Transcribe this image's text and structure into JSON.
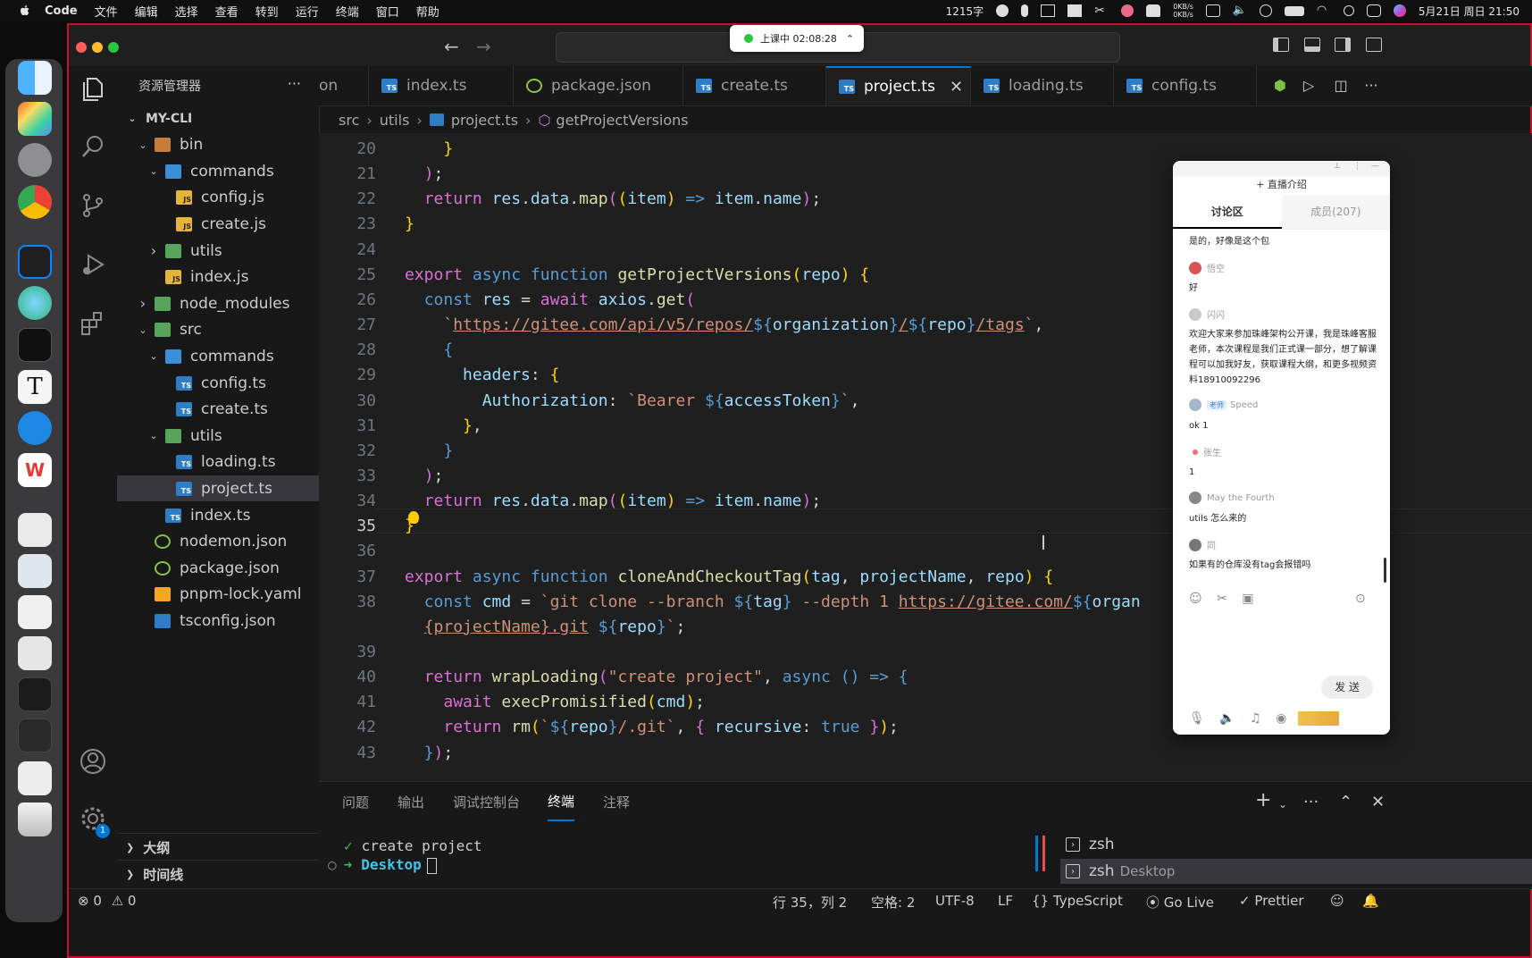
{
  "menubar": {
    "app_name": "Code",
    "items": [
      "文件",
      "编辑",
      "选择",
      "查看",
      "转到",
      "运行",
      "终端",
      "窗口",
      "帮助"
    ],
    "input_count": "1215字",
    "net_up": "0KB/s",
    "net_down": "0KB/s",
    "datetime": "5月21日 周日 21:50"
  },
  "titlebar": {
    "class_status": "上课中 02:08:28"
  },
  "sidebar": {
    "title": "资源管理器",
    "more": "···",
    "tree": [
      {
        "label": "MY-CLI",
        "depth": 0,
        "chev": "down",
        "icon": "none"
      },
      {
        "label": "bin",
        "depth": 1,
        "chev": "down",
        "icon": "folder"
      },
      {
        "label": "commands",
        "depth": 2,
        "chev": "down",
        "icon": "folder-blue"
      },
      {
        "label": "config.js",
        "depth": 3,
        "chev": "",
        "icon": "js"
      },
      {
        "label": "create.js",
        "depth": 3,
        "chev": "",
        "icon": "js"
      },
      {
        "label": "utils",
        "depth": 2,
        "chev": "right",
        "icon": "folder-green"
      },
      {
        "label": "index.js",
        "depth": 2,
        "chev": "",
        "icon": "js"
      },
      {
        "label": "node_modules",
        "depth": 1,
        "chev": "right",
        "icon": "folder-green"
      },
      {
        "label": "src",
        "depth": 1,
        "chev": "down",
        "icon": "folder-green"
      },
      {
        "label": "commands",
        "depth": 2,
        "chev": "down",
        "icon": "folder-blue"
      },
      {
        "label": "config.ts",
        "depth": 3,
        "chev": "",
        "icon": "ts"
      },
      {
        "label": "create.ts",
        "depth": 3,
        "chev": "",
        "icon": "ts"
      },
      {
        "label": "utils",
        "depth": 2,
        "chev": "down",
        "icon": "folder-green"
      },
      {
        "label": "loading.ts",
        "depth": 3,
        "chev": "",
        "icon": "ts"
      },
      {
        "label": "project.ts",
        "depth": 3,
        "chev": "",
        "icon": "ts",
        "selected": true
      },
      {
        "label": "index.ts",
        "depth": 2,
        "chev": "",
        "icon": "ts"
      },
      {
        "label": "nodemon.json",
        "depth": 1,
        "chev": "",
        "icon": "node"
      },
      {
        "label": "package.json",
        "depth": 1,
        "chev": "",
        "icon": "json"
      },
      {
        "label": "pnpm-lock.yaml",
        "depth": 1,
        "chev": "",
        "icon": "yaml"
      },
      {
        "label": "tsconfig.json",
        "depth": 1,
        "chev": "",
        "icon": "tsconfig"
      }
    ],
    "outline": "大纲",
    "timeline": "时间线"
  },
  "tabs": [
    {
      "label": "on",
      "icon": "none"
    },
    {
      "label": "index.ts",
      "icon": "ts"
    },
    {
      "label": "package.json",
      "icon": "json"
    },
    {
      "label": "create.ts",
      "icon": "ts"
    },
    {
      "label": "project.ts",
      "icon": "ts",
      "active": true
    },
    {
      "label": "loading.ts",
      "icon": "ts"
    },
    {
      "label": "config.ts",
      "icon": "ts"
    }
  ],
  "breadcrumb": [
    "src",
    "utils",
    "project.ts",
    "getProjectVersions"
  ],
  "editor": {
    "current_line": "35",
    "lines": [
      {
        "n": "20",
        "html": "    <span class='b'>}</span>"
      },
      {
        "n": "21",
        "html": "  <span class='pl'>)</span>;"
      },
      {
        "n": "22",
        "html": "  <span class='pl'>return</span> <span class='v'>res</span>.<span class='v'>data</span>.<span class='f'>map</span><span class='pl'>(</span><span class='b'>(</span><span class='v'>item</span><span class='b'>)</span> <span class='k'>=&gt;</span> <span class='v'>item</span>.<span class='v'>name</span><span class='pl'>)</span>;"
      },
      {
        "n": "23",
        "html": "<span class='b'>}</span>"
      },
      {
        "n": "24",
        "html": ""
      },
      {
        "n": "25",
        "html": "<span class='pl'>export</span> <span class='k'>async</span> <span class='k'>function</span> <span class='f'>getProjectVersions</span><span class='b'>(</span><span class='v'>repo</span><span class='b'>)</span> <span class='b'>{</span>"
      },
      {
        "n": "26",
        "html": "  <span class='k'>const</span> <span class='v'>res</span> = <span class='pl'>await</span> <span class='v'>axios</span>.<span class='f'>get</span><span class='pl'>(</span>"
      },
      {
        "n": "27",
        "html": "    <span class='s'>`</span><span class='u'>https://gitee.com/api/v5/repos/</span><span class='k'>${</span><span class='v'>organization</span><span class='k'>}</span><span class='u'>/</span><span class='k'>${</span><span class='v'>repo</span><span class='k'>}</span><span class='u'>/tags</span><span class='s'>`</span>,"
      },
      {
        "n": "28",
        "html": "    <span class='k'>{</span>"
      },
      {
        "n": "29",
        "html": "      <span class='v'>headers</span>: <span class='b'>{</span>"
      },
      {
        "n": "30",
        "html": "        <span class='v'>Authorization</span>: <span class='s'>`Bearer </span><span class='k'>${</span><span class='v'>accessToken</span><span class='k'>}</span><span class='s'>`</span>,"
      },
      {
        "n": "31",
        "html": "      <span class='b'>}</span>,"
      },
      {
        "n": "32",
        "html": "    <span class='k'>}</span>"
      },
      {
        "n": "33",
        "html": "  <span class='pl'>)</span>;"
      },
      {
        "n": "34",
        "html": "  <span class='pl'>return</span> <span class='v'>res</span>.<span class='v'>data</span>.<span class='f'>map</span><span class='pl'>(</span><span class='b'>(</span><span class='v'>item</span><span class='b'>)</span> <span class='k'>=&gt;</span> <span class='v'>item</span>.<span class='v'>name</span><span class='pl'>)</span>;"
      },
      {
        "n": "35",
        "html": "<span class='b'>}</span>"
      },
      {
        "n": "36",
        "html": ""
      },
      {
        "n": "37",
        "html": "<span class='pl'>export</span> <span class='k'>async</span> <span class='k'>function</span> <span class='f'>cloneAndCheckoutTag</span><span class='b'>(</span><span class='v'>tag</span>, <span class='v'>projectName</span>, <span class='v'>repo</span><span class='b'>)</span> <span class='b'>{</span>"
      },
      {
        "n": "38",
        "html": "  <span class='k'>const</span> <span class='v'>cmd</span> = <span class='s'>`git clone --branch </span><span class='k'>${</span><span class='v'>tag</span><span class='k'>}</span><span class='s'> --depth 1 </span><span class='u'>https://gitee.com/</span><span class='k'>${</span><span class='v'>organ</span>"
      },
      {
        "n": "",
        "html": "  <span class='u'>{projectName}.git</span><span class='s'> </span><span class='k'>${</span><span class='v'>repo</span><span class='k'>}</span><span class='s'>`</span>;"
      },
      {
        "n": "39",
        "html": ""
      },
      {
        "n": "40",
        "html": "  <span class='pl'>return</span> <span class='f'>wrapLoading</span><span class='pl'>(</span><span class='s'>\"create project\"</span>, <span class='k'>async</span> <span class='k'>()</span> <span class='k'>=&gt;</span> <span class='k'>{</span>"
      },
      {
        "n": "41",
        "html": "    <span class='pl'>await</span> <span class='f'>execPromisified</span><span class='b'>(</span><span class='v'>cmd</span><span class='b'>)</span>;"
      },
      {
        "n": "42",
        "html": "    <span class='pl'>return</span> <span class='f'>rm</span><span class='b'>(</span><span class='s'>`</span><span class='k'>${</span><span class='v'>repo</span><span class='k'>}</span><span class='s'>/.git`</span>, <span class='pl'>{</span> <span class='v'>recursive</span>: <span class='bool'>true</span> <span class='pl'>}</span><span class='b'>)</span>;"
      },
      {
        "n": "43",
        "html": "  <span class='k'>}</span><span class='pl'>)</span>;"
      }
    ]
  },
  "panel": {
    "tabs": [
      "问题",
      "输出",
      "调试控制台",
      "终端",
      "注释"
    ],
    "active_tab": "终端",
    "term_line1": "create project",
    "term_prompt": "Desktop",
    "terminals": [
      {
        "name": "zsh",
        "sub": ""
      },
      {
        "name": "zsh",
        "sub": "Desktop"
      }
    ]
  },
  "statusbar": {
    "errors": "0",
    "warnings": "0",
    "position": "行 35，列 2",
    "spaces": "空格: 2",
    "encoding": "UTF-8",
    "eol": "LF",
    "language": "TypeScript",
    "golive": "Go Live",
    "prettier": "Prettier",
    "bell_badge": "1"
  },
  "chat": {
    "intro": "+ 直播介绍",
    "tab_discuss": "讨论区",
    "tab_members": "成员(207)",
    "messages": [
      {
        "user": "",
        "text": "是的，好像是这个包"
      },
      {
        "user": "悟空",
        "text": "好"
      },
      {
        "user": "闪闪",
        "text": "欢迎大家来参加珠峰架构公开课，我是珠峰客服老师，本次课程是我们正式课一部分，想了解课程可以加我好友，获取课程大纲，和更多视频资料18910092296"
      },
      {
        "user": "Speed",
        "badge": "老师",
        "text": "ok 1"
      },
      {
        "user": "张生",
        "text": "1"
      },
      {
        "user": "May the Fourth",
        "text": "utils 怎么来的"
      },
      {
        "user": "同",
        "text": "如果有的仓库没有tag会报错吗"
      }
    ],
    "send": "发 送"
  }
}
